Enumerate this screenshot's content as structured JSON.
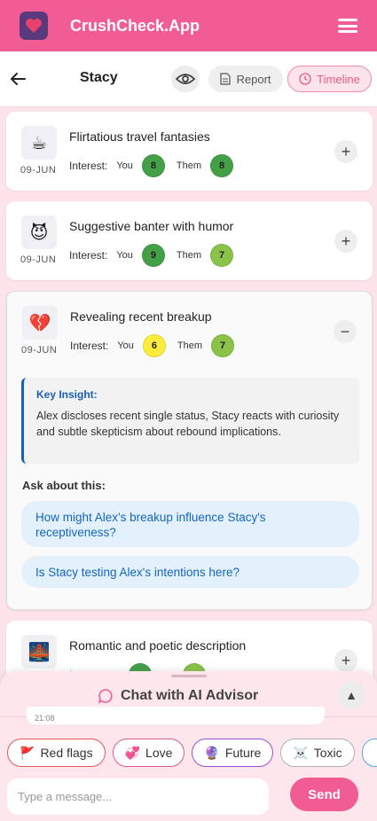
{
  "app": {
    "title": "CrushCheck.App",
    "logo_icon": "heart-chat-icon"
  },
  "nav": {
    "contact_name": "Stacy",
    "report_label": "Report",
    "timeline_label": "Timeline"
  },
  "interest_label": "Interest:",
  "you_label": "You",
  "them_label": "Them",
  "topics": [
    {
      "emoji": "☕",
      "date": "09-JUN",
      "title": "Flirtatious travel fantasies",
      "you": "8",
      "them": "8",
      "toggle": "+"
    },
    {
      "emoji": "😈",
      "date": "09-JUN",
      "title": "Suggestive banter with humor",
      "you": "9",
      "them": "7",
      "toggle": "+"
    },
    {
      "emoji": "💔",
      "date": "09-JUN",
      "title": "Revealing recent breakup",
      "you": "6",
      "them": "7",
      "toggle": "−"
    },
    {
      "emoji": "🌉",
      "date": "",
      "title": "Romantic and poetic description",
      "you": "",
      "them": "",
      "toggle": "+"
    }
  ],
  "insight": {
    "title": "Key Insight:",
    "text": "Alex discloses recent single status, Stacy reacts with curiosity and subtle skepticism about rebound implications."
  },
  "ask": {
    "title": "Ask about this:",
    "questions": [
      "How might Alex's breakup influence Stacy's receptiveness?",
      "Is Stacy testing Alex's intentions here?"
    ]
  },
  "chat": {
    "title": "Chat with AI Advisor",
    "time_stub": "21:08",
    "chips": [
      {
        "icon": "🚩",
        "label": "Red flags"
      },
      {
        "icon": "💞",
        "label": "Love"
      },
      {
        "icon": "🔮",
        "label": "Future"
      },
      {
        "icon": "☠️",
        "label": "Toxic"
      }
    ],
    "input_placeholder": "Type a message...",
    "send_label": "Send"
  },
  "colors": {
    "brand": "#f25c94",
    "score_high": "#43a047",
    "score_mid": "#8bc34a",
    "score_low": "#ffeb3b"
  }
}
